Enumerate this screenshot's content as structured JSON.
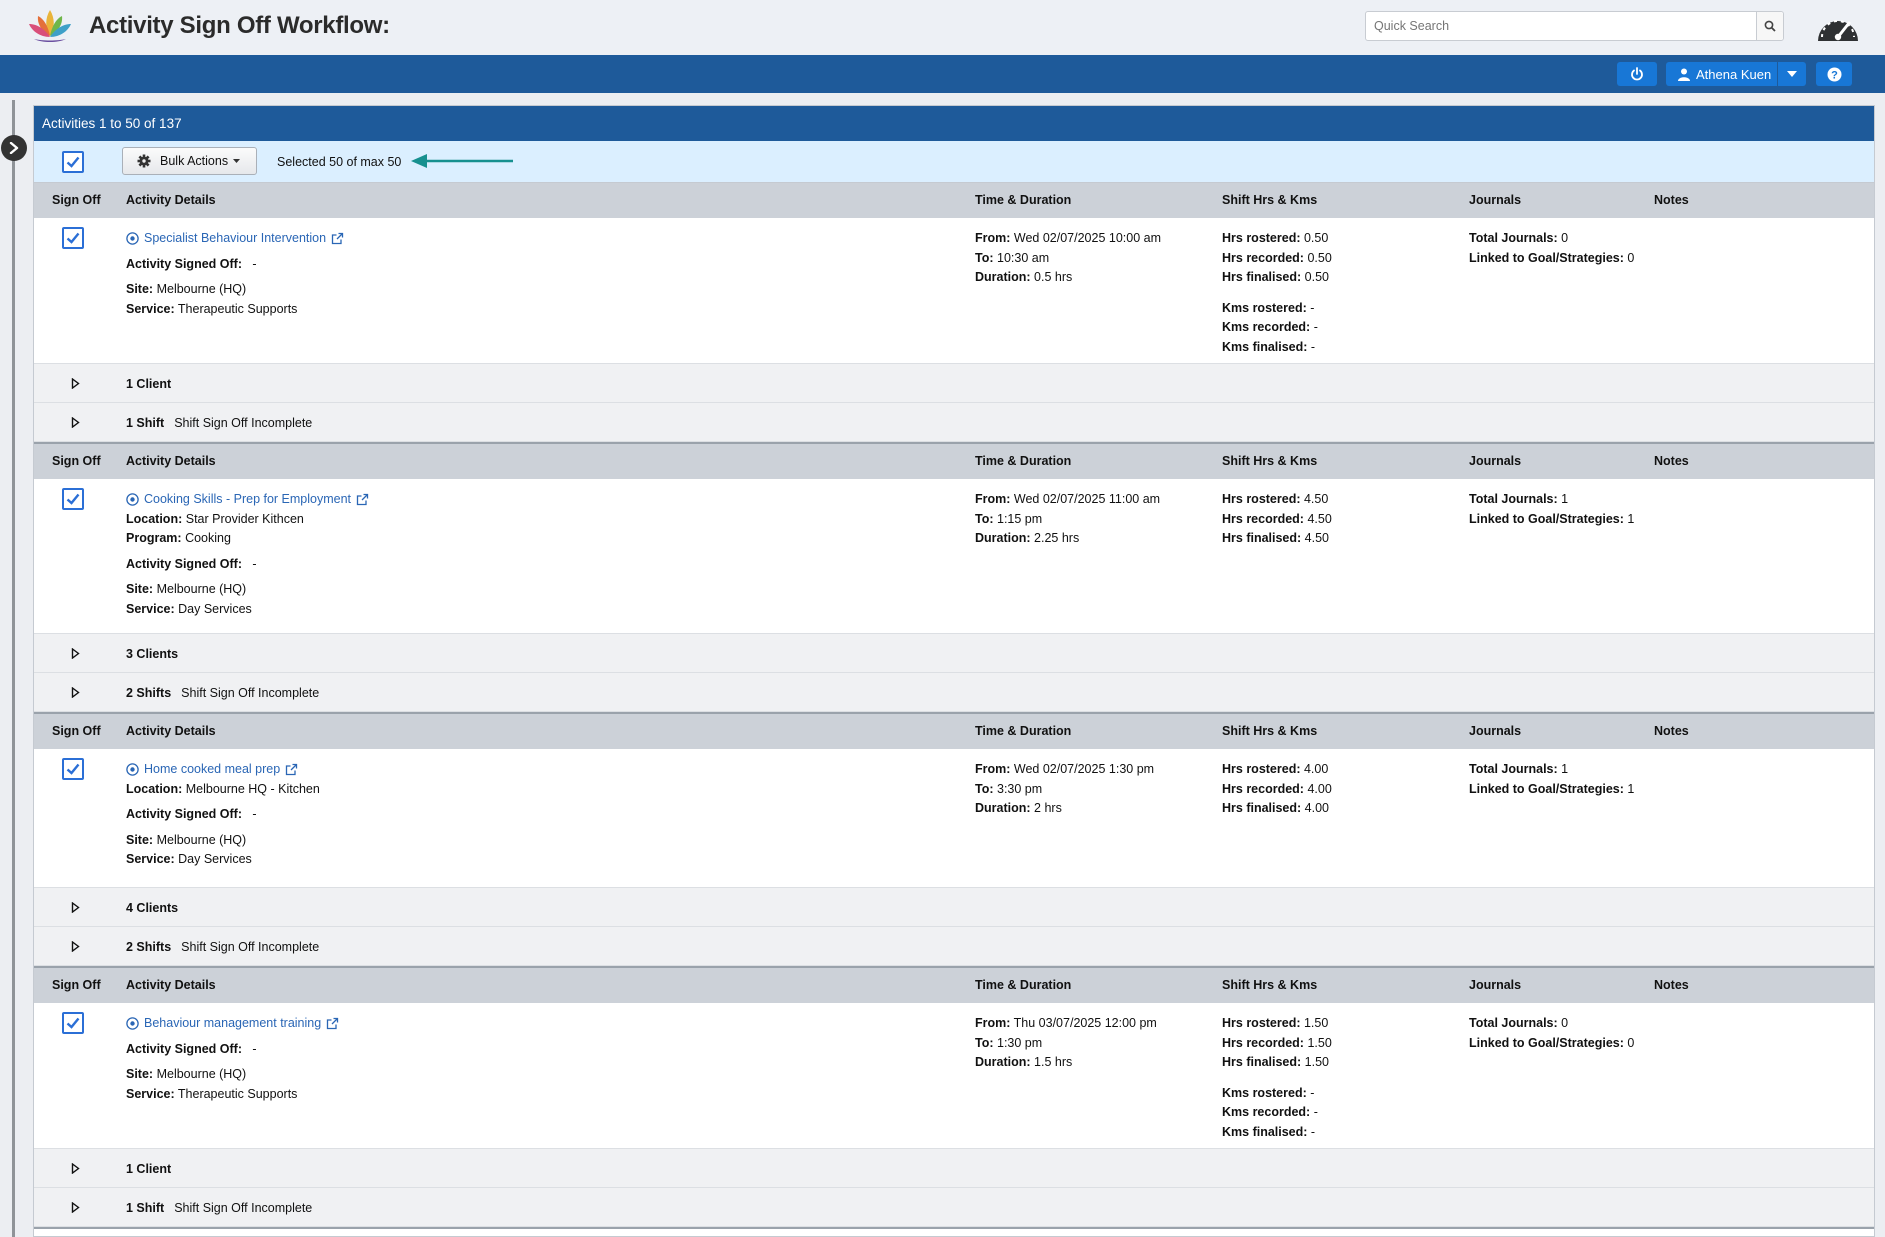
{
  "header": {
    "title": "Activity Sign Off Workflow:",
    "search_placeholder": "Quick Search"
  },
  "nav": {
    "user_name": "Athena Kuen"
  },
  "panel": {
    "title": "Activities 1 to 50 of 137",
    "bulk_actions_label": "Bulk Actions",
    "selected_text": "Selected 50 of max 50"
  },
  "columns": {
    "sign_off": "Sign Off",
    "activity_details": "Activity Details",
    "time_duration": "Time & Duration",
    "shift_hrs_kms": "Shift Hrs & Kms",
    "journals": "Journals",
    "notes": "Notes"
  },
  "labels": {
    "activity_signed_off": "Activity Signed Off:",
    "location": "Location:",
    "program": "Program:",
    "site": "Site:",
    "service": "Service:",
    "from": "From:",
    "to": "To:",
    "duration": "Duration:",
    "hrs_rostered": "Hrs rostered:",
    "hrs_recorded": "Hrs recorded:",
    "hrs_finalised": "Hrs finalised:",
    "kms_rostered": "Kms rostered:",
    "kms_recorded": "Kms recorded:",
    "kms_finalised": "Kms finalised:",
    "total_journals": "Total Journals:",
    "linked_goals": "Linked to Goal/Strategies:"
  },
  "activities": [
    {
      "name": "Specialist Behaviour Intervention",
      "signed_off": "-",
      "site": "Melbourne (HQ)",
      "service": "Therapeutic Supports",
      "from": "Wed 02/07/2025 10:00 am",
      "to": "10:30 am",
      "duration": "0.5 hrs",
      "hrs_rostered": "0.50",
      "hrs_recorded": "0.50",
      "hrs_finalised": "0.50",
      "kms_rostered": "-",
      "kms_recorded": "-",
      "kms_finalised": "-",
      "total_journals": "0",
      "linked_goals": "0",
      "clients": "1 Client",
      "shifts": "1 Shift",
      "shift_status": "Shift Sign Off Incomplete"
    },
    {
      "name": "Cooking Skills - Prep for Employment",
      "location": "Star Provider Kithcen",
      "program": "Cooking",
      "signed_off": "-",
      "site": "Melbourne (HQ)",
      "service": "Day Services",
      "from": "Wed 02/07/2025 11:00 am",
      "to": "1:15 pm",
      "duration": "2.25 hrs",
      "hrs_rostered": "4.50",
      "hrs_recorded": "4.50",
      "hrs_finalised": "4.50",
      "total_journals": "1",
      "linked_goals": "1",
      "clients": "3 Clients",
      "shifts": "2 Shifts",
      "shift_status": "Shift Sign Off Incomplete"
    },
    {
      "name": "Home cooked meal prep",
      "location": "Melbourne HQ - Kitchen",
      "signed_off": "-",
      "site": "Melbourne (HQ)",
      "service": "Day Services",
      "from": "Wed 02/07/2025 1:30 pm",
      "to": "3:30 pm",
      "duration": "2 hrs",
      "hrs_rostered": "4.00",
      "hrs_recorded": "4.00",
      "hrs_finalised": "4.00",
      "total_journals": "1",
      "linked_goals": "1",
      "clients": "4 Clients",
      "shifts": "2 Shifts",
      "shift_status": "Shift Sign Off Incomplete"
    },
    {
      "name": "Behaviour management training",
      "signed_off": "-",
      "site": "Melbourne (HQ)",
      "service": "Therapeutic Supports",
      "from": "Thu 03/07/2025 12:00 pm",
      "to": "1:30 pm",
      "duration": "1.5 hrs",
      "hrs_rostered": "1.50",
      "hrs_recorded": "1.50",
      "hrs_finalised": "1.50",
      "kms_rostered": "-",
      "kms_recorded": "-",
      "kms_finalised": "-",
      "total_journals": "0",
      "linked_goals": "0",
      "clients": "1 Client",
      "shifts": "1 Shift",
      "shift_status": "Shift Sign Off Incomplete"
    }
  ],
  "colors": {
    "brand_blue": "#1e5a9a",
    "button_blue": "#1877d6",
    "link_blue": "#2a66b5",
    "annotation_arrow": "#16908f"
  }
}
